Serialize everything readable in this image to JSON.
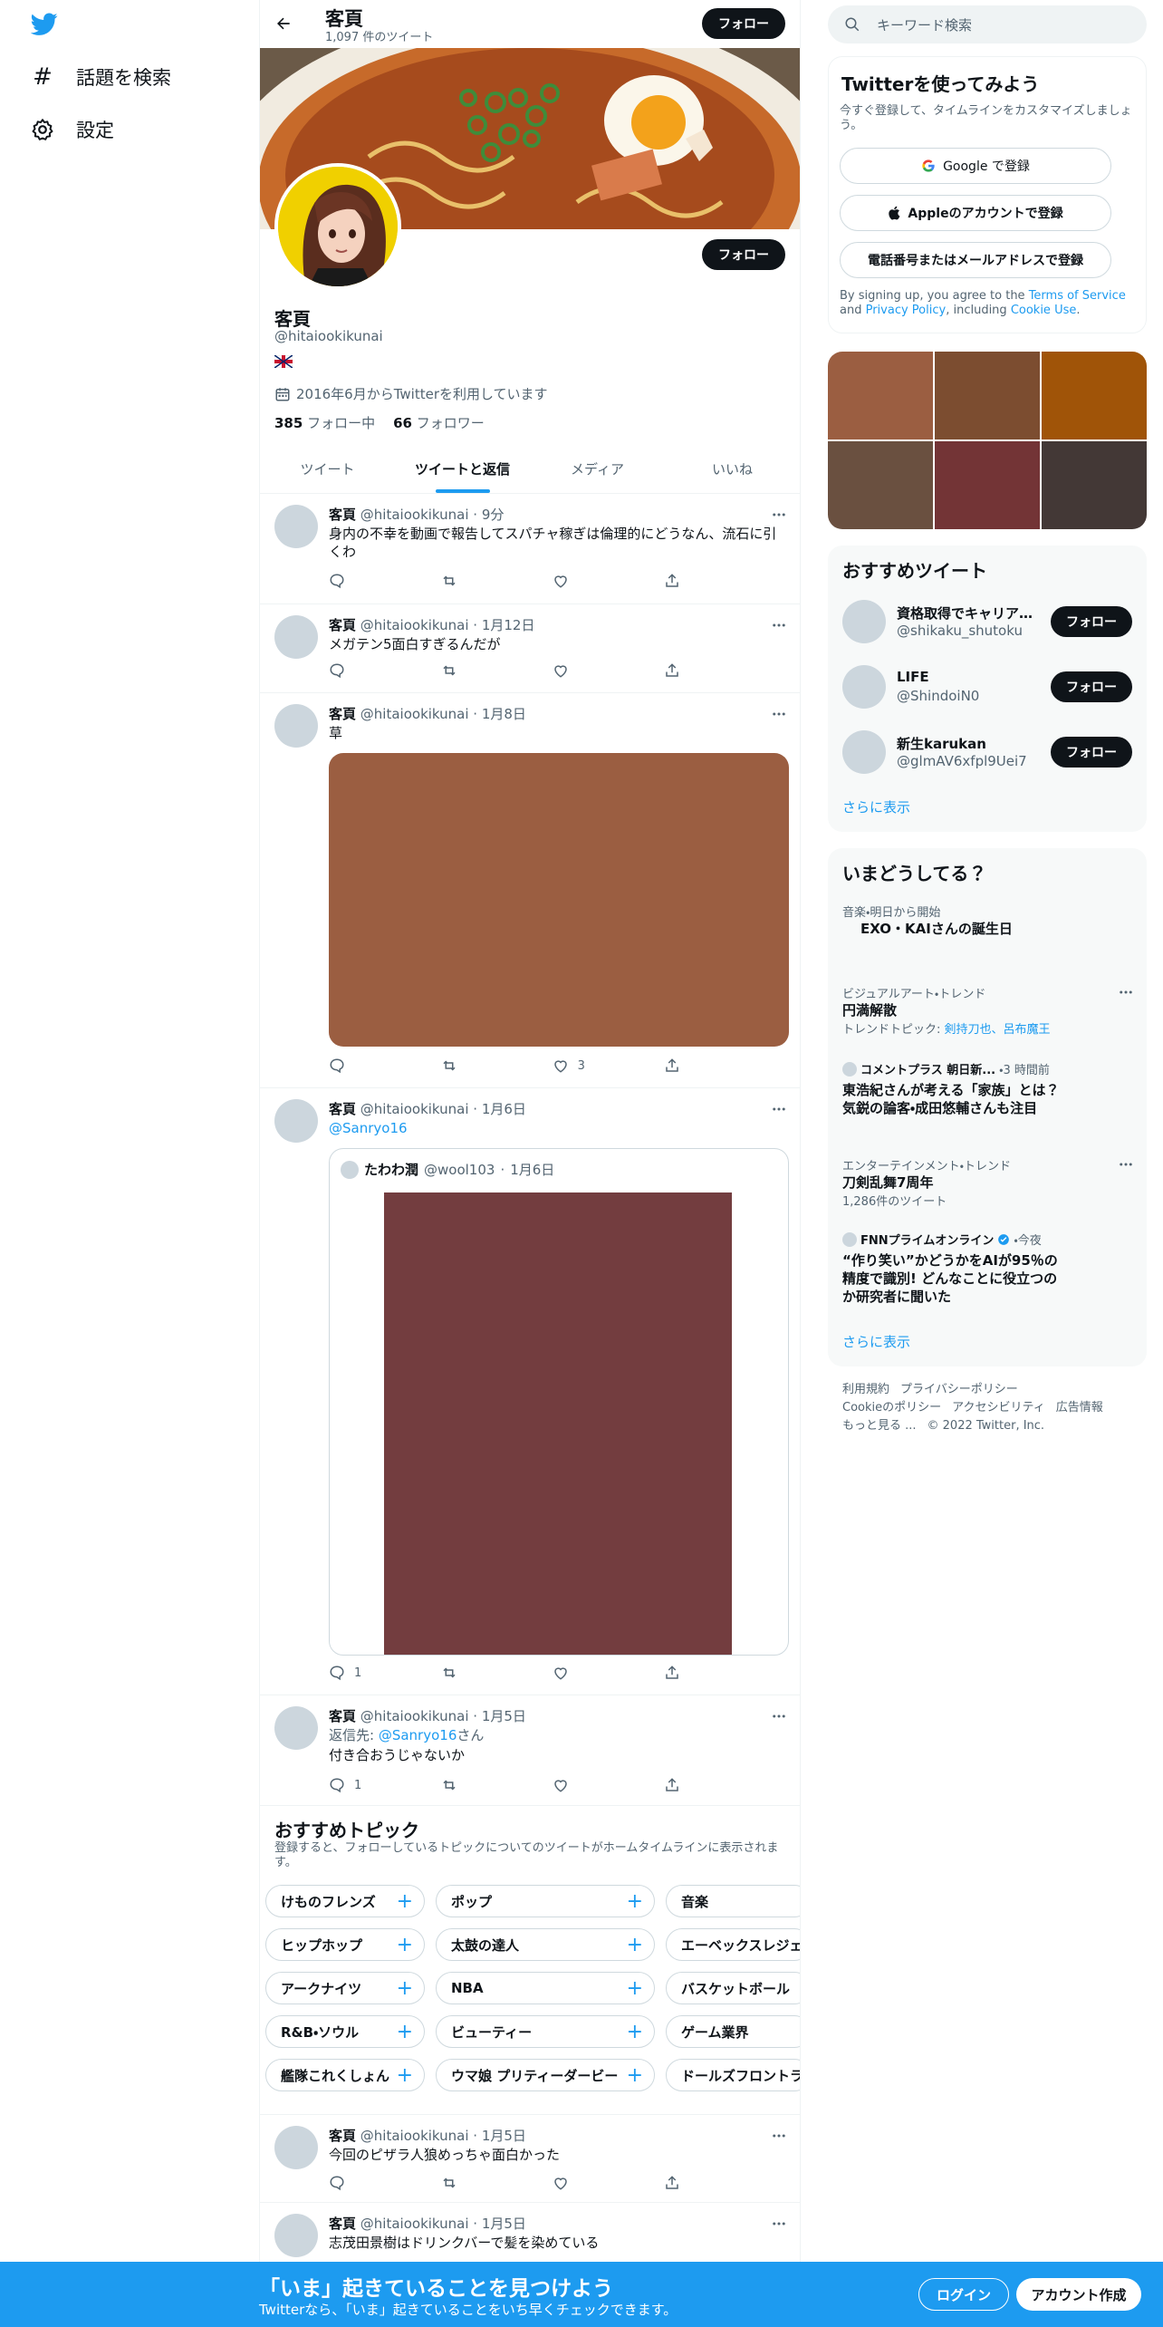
{
  "nav": {
    "explore_label": "話題を検索",
    "settings_label": "設定"
  },
  "header": {
    "name": "客頁",
    "tweet_count": "1,097 件のツイート",
    "follow_label": "フォロー"
  },
  "profile": {
    "name": "客頁",
    "handle": "@hitaiookikunai",
    "joined": "2016年6月からTwitterを利用しています",
    "following_count": "385",
    "following_label": "フォロー中",
    "followers_count": "66",
    "followers_label": "フォロワー",
    "follow_label": "フォロー"
  },
  "tabs": [
    "ツイート",
    "ツイートと返信",
    "メディア",
    "いいね"
  ],
  "tweets": [
    {
      "name": "客頁",
      "handle": "@hitaiookikunai",
      "time": "9分",
      "text": "身内の不幸を動画で報告してスパチャ稼ぎは倫理的にどうなん、流石に引くわ"
    },
    {
      "name": "客頁",
      "handle": "@hitaiookikunai",
      "time": "1月12日",
      "text": "メガテン5面白すぎるんだが"
    },
    {
      "name": "客頁",
      "handle": "@hitaiookikunai",
      "time": "1月8日",
      "text": "草",
      "likes": "3",
      "media_color": "#9b5e41"
    },
    {
      "name": "客頁",
      "handle": "@hitaiookikunai",
      "time": "1月6日",
      "text": "@Sanryo16",
      "replies": "1",
      "quote": {
        "name": "たわわ潤",
        "handle": "@wool103",
        "time": "1月6日",
        "media_color": "#733d3f"
      }
    },
    {
      "name": "客頁",
      "handle": "@hitaiookikunai",
      "time": "1月5日",
      "reply_prefix": "返信先: ",
      "reply_to": "@Sanryo16",
      "reply_suffix": "さん",
      "text": "付き合おうじゃないか",
      "replies": "1"
    },
    {
      "name": "客頁",
      "handle": "@hitaiookikunai",
      "time": "1月5日",
      "text": "今回のピザラ人狼めっちゃ面白かった"
    },
    {
      "name": "客頁",
      "handle": "@hitaiookikunai",
      "time": "1月5日",
      "text": "志茂田景樹はドリンクバーで髪を染めている"
    }
  ],
  "topics": {
    "title": "おすすめトピック",
    "subtitle": "登録すると、フォローしているトピックについてのツイートがホームタイムラインに表示されます。",
    "items": [
      "けものフレンズ",
      "ポップ",
      "音楽",
      "ヒップホップ",
      "太鼓の達人",
      "エーベックスレジェ",
      "アークナイツ",
      "NBA",
      "バスケットボール",
      "R&B・ソウル",
      "ビューティー",
      "ゲーム業界",
      "艦隊これくしょん",
      "ウマ娘 プリティーダービー",
      "ドールズフロントラ"
    ]
  },
  "search": {
    "placeholder": "キーワード検索"
  },
  "signup": {
    "title": "Twitterを使ってみよう",
    "subtitle": "今すぐ登録して、タイムラインをカスタマイズしましょう。",
    "google": "Google で登録",
    "apple": "Appleのアカウントで登録",
    "phone": "電話番号またはメールアドレスで登録",
    "legal_1": "By signing up, you agree to the ",
    "tos": "Terms of Service",
    "legal_2": " and ",
    "privacy": "Privacy Policy",
    "legal_3": ", including ",
    "cookie": "Cookie Use",
    "legal_4": "."
  },
  "photos": [
    "#9b5e41",
    "#7c4d30",
    "#a05408",
    "#6a5040",
    "#733436",
    "#433836"
  ],
  "who_to_follow": {
    "title": "おすすめツイート",
    "show_more": "さらに表示",
    "items": [
      {
        "name": "資格取得でキャリアアップ",
        "handle": "@shikaku_shutoku",
        "follow": "フォロー"
      },
      {
        "name": "LIFE",
        "handle": "@ShindoiN0",
        "follow": "フォロー"
      },
      {
        "name": "新生karukan",
        "handle": "@glmAV6xfpl9Uei7",
        "follow": "フォロー"
      }
    ]
  },
  "trends": {
    "title": "いまどうしてる？",
    "show_more": "さらに表示",
    "items": [
      {
        "cat": "音楽・明日から開始",
        "topic": "EXO・KAIさんの誕生日"
      },
      {
        "cat": "ビジュアルアート・トレンド",
        "topic": "円満解散",
        "sub_prefix": "トレンドトピック: ",
        "sub_links": "剣持刀也、呂布魔王"
      },
      {
        "source": "コメントプラス 朝日新...",
        "time": "・3 時間前",
        "topic": "東浩紀さんが考える「家族」とは？　気鋭の論客・成田悠輔さんも注目"
      },
      {
        "cat": "エンターテインメント・トレンド",
        "topic": "刀剣乱舞7周年",
        "count": "1,286件のツイート"
      },
      {
        "source": "FNNプライムオンライン",
        "time": "・今夜",
        "topic": "“作り笑い”かどうかをAIが95％の精度で識別! どんなことに役立つのか研究者に聞いた"
      }
    ]
  },
  "footer": {
    "links": [
      "利用規約",
      "プライバシーポリシー",
      "Cookieのポリシー",
      "アクセシビリティ",
      "広告情報",
      "もっと見る ..."
    ],
    "copyright": "© 2022 Twitter, Inc."
  },
  "bottom_bar": {
    "title": "「いま」起きていることを見つけよう",
    "subtitle": "Twitterなら、「いま」起きていることをいち早くチェックできます。",
    "login": "ログイン",
    "signup": "アカウント作成"
  },
  "colors": {
    "accent": "#1d9bf0",
    "text": "#0f1419",
    "muted": "#536471"
  }
}
